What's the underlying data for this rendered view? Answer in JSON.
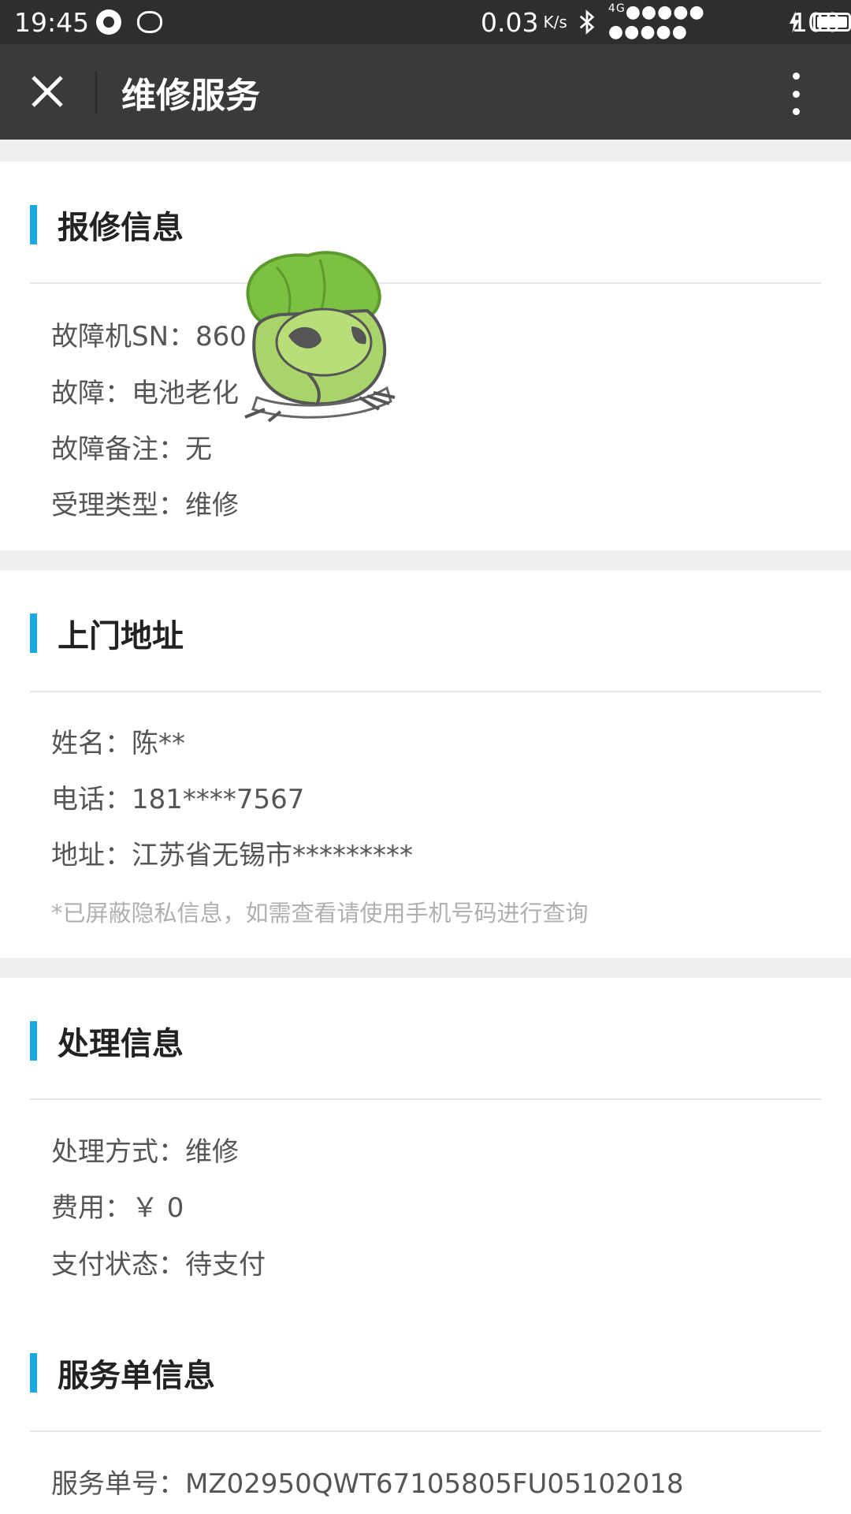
{
  "status_bar": {
    "time": "19:45",
    "speed": "0.03",
    "speed_unit": "K/s",
    "network": "4G",
    "battery": "100"
  },
  "header": {
    "title": "维修服务"
  },
  "repair_info": {
    "title": "报修信息",
    "rows": [
      "故障机SN：860",
      "故障：电池老化",
      "故障备注：无",
      "受理类型：维修"
    ]
  },
  "address": {
    "title": "上门地址",
    "rows": [
      "姓名：陈**",
      "电话：181****7567",
      "地址：江苏省无锡市*********"
    ],
    "note": "*已屏蔽隐私信息，如需查看请使用手机号码进行查询"
  },
  "processing": {
    "title": "处理信息",
    "rows": [
      "处理方式：维修",
      "费用：￥ 0",
      "支付状态：待支付"
    ]
  },
  "service_order": {
    "title": "服务单信息",
    "rows": [
      "服务单号：MZ02950QWT67105805FU05102018"
    ]
  },
  "icons": [
    "close-icon",
    "more-icon",
    "bluetooth-icon",
    "charging-icon",
    "battery-icon",
    "frog-sticker"
  ],
  "colors": {
    "accent": "#1aa8e0",
    "header_bg": "#3a3a3a",
    "status_bg": "#2e2e2e"
  }
}
